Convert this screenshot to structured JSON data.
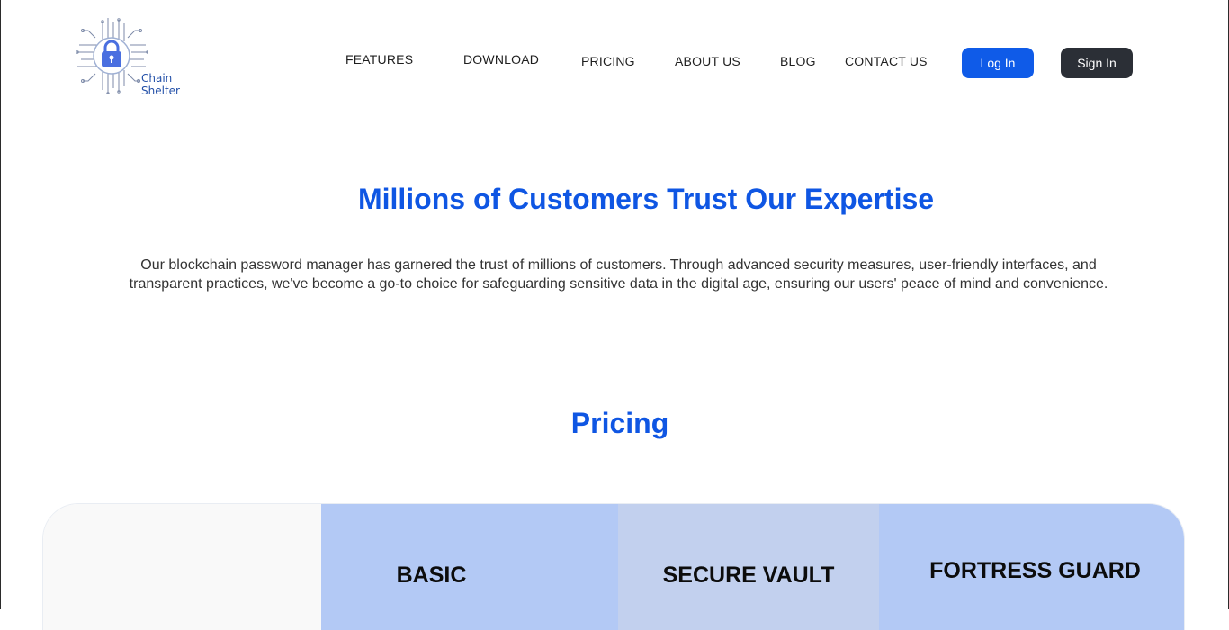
{
  "brand": {
    "name_line1": "Chain",
    "name_line2": "Shelter",
    "logo_icon": "padlock-circuit-icon",
    "logo_color": "#4a6fe0"
  },
  "nav": {
    "items": [
      {
        "label": "FEATURES"
      },
      {
        "label": "DOWNLOAD"
      },
      {
        "label": "PRICING"
      },
      {
        "label": "ABOUT US"
      },
      {
        "label": "BLOG"
      },
      {
        "label": "CONTACT US"
      }
    ],
    "login_label": "Log In",
    "signin_label": "Sign In"
  },
  "hero": {
    "title": "Millions of Customers Trust Our Expertise",
    "description": "Our blockchain password manager has garnered the trust of millions of customers. Through advanced security measures, user-friendly interfaces, and transparent practices, we've become a go-to choice for safeguarding sensitive data in the digital age, ensuring our users' peace of mind and convenience."
  },
  "pricing": {
    "title": "Pricing",
    "plans": [
      {
        "name": "BASIC"
      },
      {
        "name": "SECURE VAULT"
      },
      {
        "name": "FORTRESS GUARD"
      }
    ]
  },
  "colors": {
    "accent": "#0f56e3",
    "login_button": "#0f5be8",
    "signin_button": "#2b2f36",
    "plan_basic_bg": "#b3c9f5",
    "plan_vault_bg": "#c2d0ee",
    "plan_fortress_bg": "#b3c9f5"
  }
}
